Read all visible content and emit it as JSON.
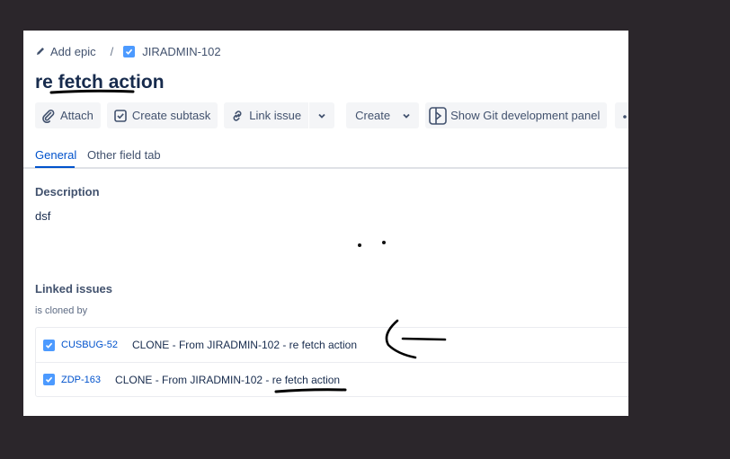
{
  "breadcrumbs": {
    "add_epic": "Add epic",
    "separator": "/",
    "issue_key": "JIRADMIN-102"
  },
  "issue": {
    "title": "re fetch action"
  },
  "toolbar": {
    "attach": "Attach",
    "create_subtask": "Create subtask",
    "link_issue": "Link issue",
    "create": "Create",
    "git_panel": "Show Git development panel"
  },
  "tabs": [
    {
      "label": "General",
      "active": true
    },
    {
      "label": "Other field tab",
      "active": false
    }
  ],
  "description": {
    "label": "Description",
    "value": "dsf"
  },
  "linked_issues": {
    "label": "Linked issues",
    "relation": "is cloned by",
    "items": [
      {
        "key": "CUSBUG-52",
        "summary": "CLONE - From JIRADMIN-102 - re fetch action"
      },
      {
        "key": "ZDP-163",
        "summary": "CLONE - From JIRADMIN-102 - re fetch action"
      }
    ]
  },
  "colors": {
    "background": "#2b262b",
    "link": "#0052cc",
    "task_checkbox": "#4c9aff",
    "button_bg": "#f4f5f7"
  },
  "icons": [
    "pencil-icon",
    "task-checkbox-icon",
    "paperclip-icon",
    "subtask-icon",
    "link-icon",
    "chevron-down-icon",
    "git-panel-icon",
    "more-icon"
  ]
}
